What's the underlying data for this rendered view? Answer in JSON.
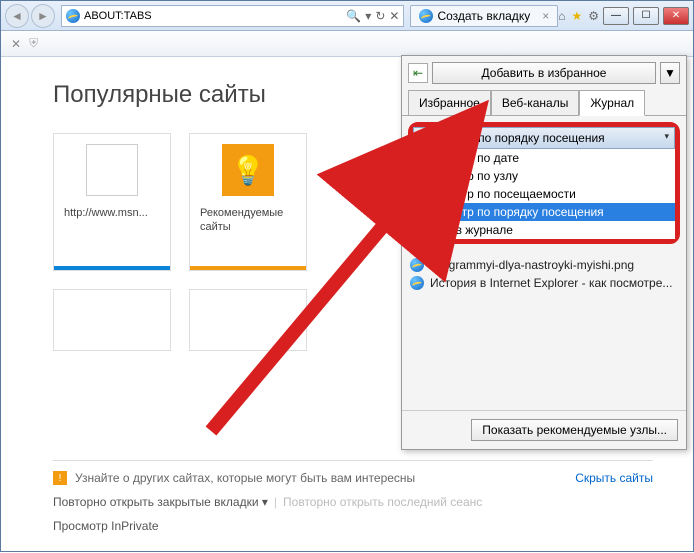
{
  "window": {
    "address": "about:Tabs",
    "tab_title": "Создать вкладку"
  },
  "page": {
    "heading": "Популярные сайты",
    "tiles": [
      {
        "label": "http://www.msn...",
        "bar": "blue",
        "thumb": "blank"
      },
      {
        "label": "Рекомендуемые сайты",
        "bar": "orange",
        "thumb": "orange"
      }
    ],
    "promo": "Узнайте о других сайтах, которые могут быть вам интересны",
    "hide_sites": "Скрыть сайты",
    "reopen_closed": "Повторно открыть закрытые вкладки",
    "reopen_last": "Повторно открыть последний сеанс",
    "inprivate": "Просмотр InPrivate"
  },
  "favorites": {
    "add_button": "Добавить в избранное",
    "tabs": [
      "Избранное",
      "Веб-каналы",
      "Журнал"
    ],
    "active_tab": 2,
    "sort_selected": "Просмотр по порядку посещения",
    "sort_options": [
      "Просмотр по дате",
      "Просмотр по узлу",
      "Просмотр по посещаемости",
      "Просмотр по порядку посещения",
      "Поиск в журнале"
    ],
    "highlighted_option": 3,
    "history": [
      "Programmyi-dlya-nastroyki-myishi.png",
      "История в Internet Explorer - как посмотре..."
    ],
    "recommend_button": "Показать рекомендуемые узлы..."
  }
}
